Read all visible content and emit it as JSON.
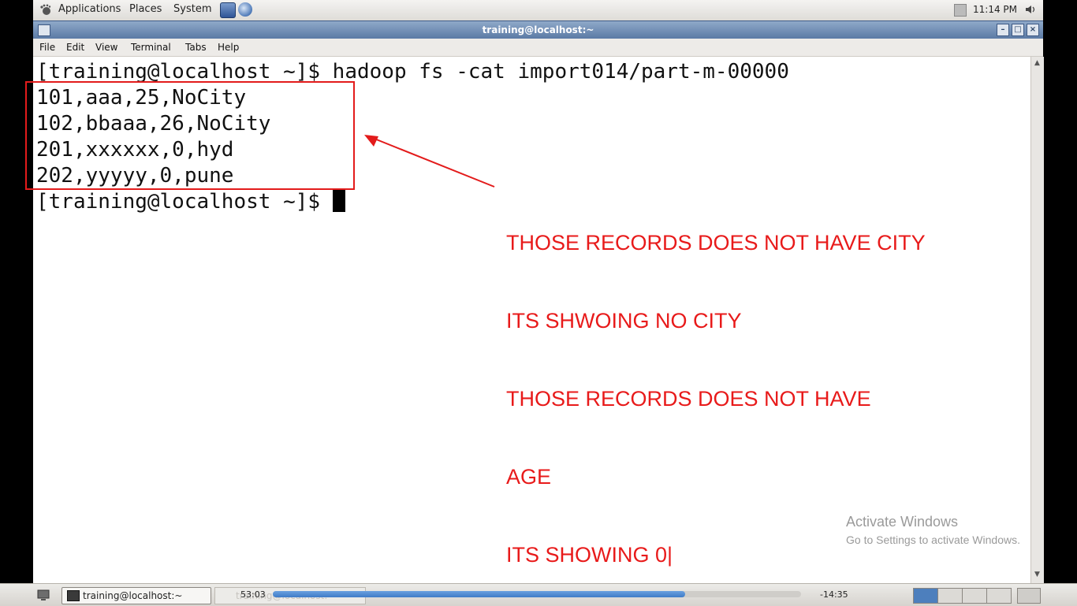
{
  "panel": {
    "menus": [
      "Applications",
      "Places",
      "System"
    ],
    "clock": "11:14 PM"
  },
  "window": {
    "title": "training@localhost:~",
    "menus": [
      "File",
      "Edit",
      "View",
      "Terminal",
      "Tabs",
      "Help"
    ]
  },
  "terminal": {
    "lines": [
      "[training@localhost ~]$ hadoop fs -cat import014/part-m-00000",
      "101,aaa,25,NoCity",
      "102,bbaaa,26,NoCity",
      "201,xxxxxx,0,hyd",
      "202,yyyyy,0,pune"
    ],
    "prompt": "[training@localhost ~]$ "
  },
  "annotation": {
    "note_lines": [
      "THOSE RECORDS DOES NOT HAVE CITY",
      "ITS SHWOING NO CITY",
      "THOSE RECORDS DOES NOT HAVE",
      "AGE",
      "ITS SHOWING 0|"
    ],
    "color": "#e81a1a"
  },
  "watermark": {
    "title": "Activate Windows",
    "subtitle": "Go to Settings to activate Windows."
  },
  "taskbar": {
    "task_label": "training@localhost:~",
    "ghost_label": "training@localhost:~",
    "time_elapsed": "53:03",
    "time_remaining": "-14:35",
    "progress": 0.78
  }
}
